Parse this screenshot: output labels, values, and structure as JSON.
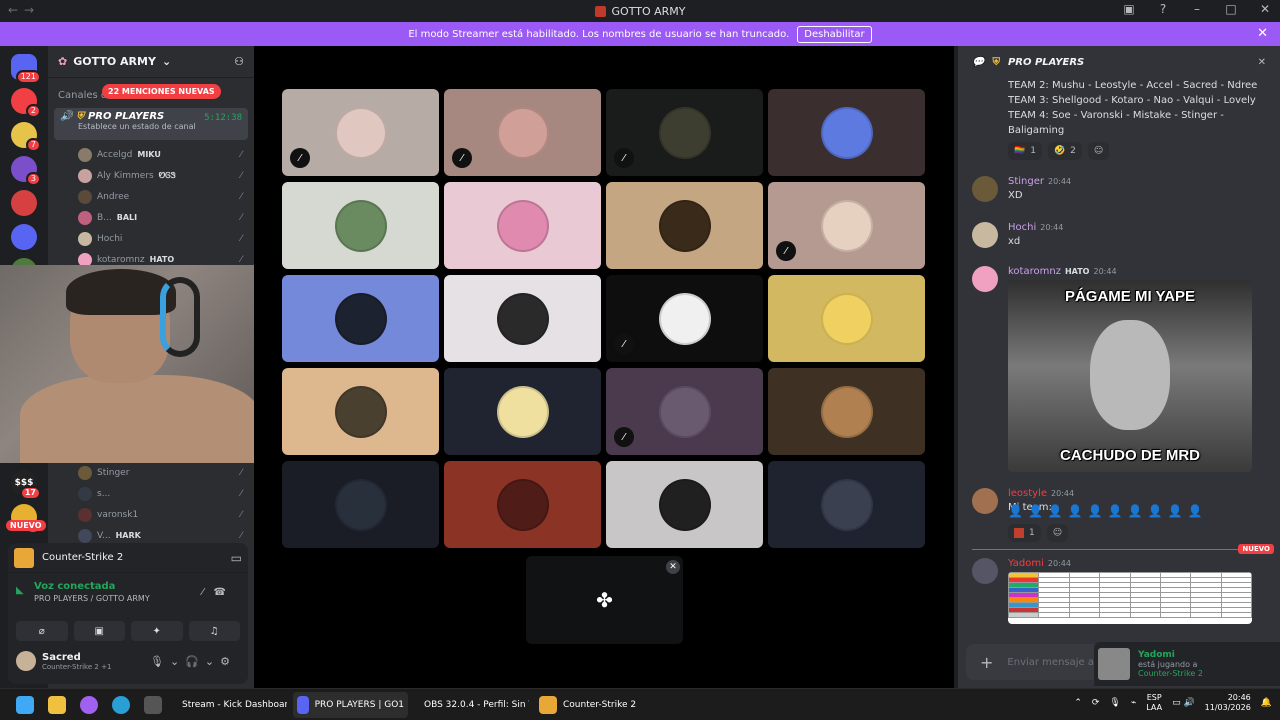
{
  "window": {
    "title": "GOTTO ARMY"
  },
  "banner": {
    "text": "El modo Streamer está habilitado. Los nombres de usuario se han truncado.",
    "button": "Deshabilitar"
  },
  "guilds": {
    "home_badge": "121",
    "items": [
      {
        "color": "#f23f43",
        "badge": "2"
      },
      {
        "color": "#e6c44a",
        "badge": "7"
      },
      {
        "color": "#7a4fc9",
        "badge": "3"
      },
      {
        "color": "#d64040",
        "badge": ""
      },
      {
        "color": "#5865f2",
        "badge": ""
      },
      {
        "color": "#4f7a3d",
        "badge": "22"
      },
      {
        "color": "#aaa",
        "badge": ""
      }
    ],
    "lower": [
      {
        "label": "$$$",
        "badge": "17"
      },
      {
        "label": "",
        "badge": "6"
      }
    ],
    "new_label": "NUEVO"
  },
  "sidebar": {
    "server_name": "GOTTO ARMY",
    "channels_label": "Canales de",
    "mentions_pill": "22 MENCIONES NUEVAS",
    "voice_channel": {
      "name": "PRO PLAYERS",
      "time": "5:12:38",
      "status": "Establece un estado de canal"
    },
    "users": [
      {
        "name": "Accelgd",
        "tag": "MIKU",
        "color": "#8a7a6a"
      },
      {
        "name": "Aly Kimmers",
        "tag": "ᏬᎶᏕ",
        "color": "#c8a2a0"
      },
      {
        "name": "Andree",
        "tag": "",
        "color": "#5a4a3a"
      },
      {
        "name": "B...",
        "tag": "BALI",
        "color": "#c06080"
      },
      {
        "name": "Hochi",
        "tag": "",
        "color": "#c9b8a0"
      },
      {
        "name": "kotaromnz",
        "tag": "HATO",
        "color": "#f0a0c0"
      }
    ],
    "lower_users": [
      {
        "name": "Stinger",
        "tag": "",
        "color": "#6b5a3a"
      },
      {
        "name": "s...",
        "tag": "",
        "color": "#333a44"
      },
      {
        "name": "varonsk1",
        "tag": "",
        "color": "#5a3030"
      },
      {
        "name": "V...",
        "tag": "HARK",
        "color": "#404859"
      }
    ]
  },
  "activity": {
    "game": "Counter-Strike 2"
  },
  "voice_status": {
    "connected": "Voz conectada",
    "channel": "PRO PLAYERS",
    "server": "/ GOTTO ARMY"
  },
  "user_panel": {
    "name": "Sacred",
    "status": "Counter-Strike 2 +1"
  },
  "tiles": [
    {
      "bg": "#b7aba5",
      "pfp": "#e0c8c0",
      "muted": true
    },
    {
      "bg": "#a68880",
      "pfp": "#d0a098",
      "muted": true
    },
    {
      "bg": "#1a1c1b",
      "pfp": "#3e3e30",
      "muted": true
    },
    {
      "bg": "#3a2e2e",
      "pfp": "#5d7ae0",
      "muted": false
    },
    {
      "bg": "#d5d9d2",
      "pfp": "#6a8a60",
      "muted": false
    },
    {
      "bg": "#e8c9d4",
      "pfp": "#e08ab0",
      "muted": false
    },
    {
      "bg": "#c4a683",
      "pfp": "#3a2a1a",
      "muted": false
    },
    {
      "bg": "#b49a90",
      "pfp": "#e6d0c0",
      "muted": true
    },
    {
      "bg": "#7489d9",
      "pfp": "#1c2230",
      "muted": false
    },
    {
      "bg": "#e6e1e5",
      "pfp": "#2a2a2a",
      "muted": false
    },
    {
      "bg": "#0e0e0e",
      "pfp": "#f0f0f0",
      "muted": true
    },
    {
      "bg": "#d2b860",
      "pfp": "#f0d060",
      "muted": false
    },
    {
      "bg": "#ddb78e",
      "pfp": "#4a4030",
      "muted": false
    },
    {
      "bg": "#202430",
      "pfp": "#f0e0a0",
      "muted": false
    },
    {
      "bg": "#4b3a4d",
      "pfp": "#6a5a70",
      "muted": true
    },
    {
      "bg": "#3e3022",
      "pfp": "#b08050",
      "muted": false
    },
    {
      "bg": "#1a1d26",
      "pfp": "#28303c",
      "muted": false
    },
    {
      "bg": "#8b3426",
      "pfp": "#501c18",
      "muted": false
    },
    {
      "bg": "#c8c6c7",
      "pfp": "#202020",
      "muted": false
    },
    {
      "bg": "#1f2330",
      "pfp": "#3a4050",
      "muted": false
    }
  ],
  "chat": {
    "channel": "PRO PLAYERS",
    "teams": [
      "TEAM 2: Mushu - Leostyle - Accel - Sacred - Ndree",
      "TEAM 3: Shellgood - Kotaro - Nao - Valqui - Lovely",
      "TEAM 4: Soe - Varonski - Mistake - Stinger -",
      "Baligaming"
    ],
    "reactions": [
      {
        "emoji": "🏳️‍🌈",
        "count": "1"
      },
      {
        "emoji": "🤣",
        "count": "2"
      }
    ],
    "messages": [
      {
        "author": "Stinger",
        "time": "20:44",
        "text": "XD",
        "color": "#dbdee1",
        "avcolor": "#6b5a3a"
      },
      {
        "author": "Hochi",
        "time": "20:44",
        "text": "xd",
        "color": "#dbdee1",
        "avcolor": "#c9b8a0"
      },
      {
        "author": "kotaromnz",
        "tag": "HATO",
        "time": "20:44",
        "text": "",
        "color": "#dbdee1",
        "avcolor": "#f0a0c0"
      },
      {
        "author": "leostyle",
        "time": "20:44",
        "text": "Mi team:",
        "color": "#f23f43",
        "avcolor": "#a07050"
      },
      {
        "author": "Yadomi",
        "time": "20:44",
        "text": "",
        "color": "#f23f43",
        "avcolor": "#556"
      }
    ],
    "meme_top": "PÁGAME MI YAPE",
    "meme_bottom": "CACHUDO DE MRD",
    "leo_reaction_count": "1",
    "new_label": "NUEVO",
    "placeholder": "Enviar mensaje a"
  },
  "toast": {
    "name": "Yadomi",
    "status": "está jugando a",
    "game": "Counter-Strike 2"
  },
  "taskbar": {
    "apps": [
      {
        "label": "Stream - Kick Dashboar",
        "color": "#e0412f"
      },
      {
        "label": "PRO PLAYERS | GO1",
        "color": "#5865f2"
      },
      {
        "label": "OBS 32.0.4 - Perfil: Sin T",
        "color": "#333"
      },
      {
        "label": "Counter-Strike 2",
        "color": "#e8a838"
      }
    ],
    "lang": "ESP",
    "lang2": "LAA",
    "time": "20:46",
    "date": "11/03/2026"
  }
}
